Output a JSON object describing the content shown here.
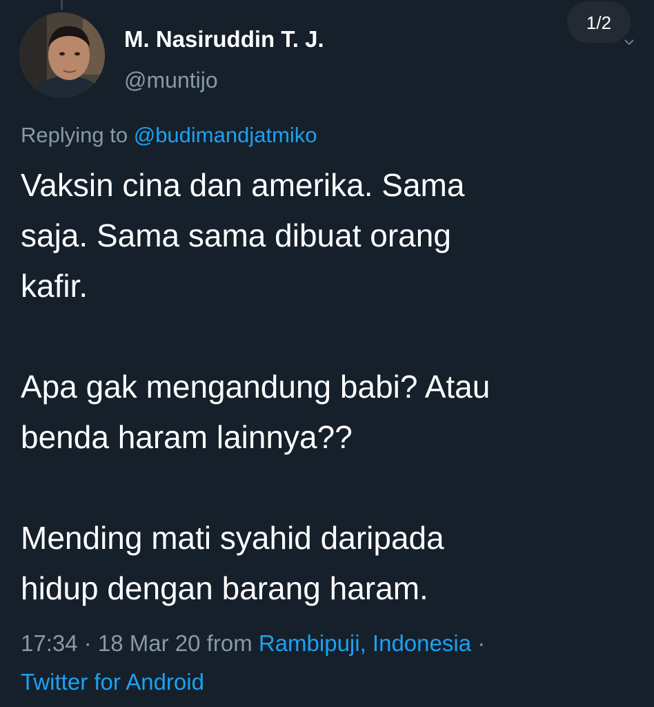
{
  "tweet": {
    "author": {
      "name": "M. Nasiruddin T. J.",
      "handle": "@muntijo"
    },
    "page_indicator": "1/2",
    "reply": {
      "prefix": "Replying to ",
      "mention": "@budimandjatmiko"
    },
    "text_lines": [
      "Vaksin cina dan amerika. Sama",
      "saja. Sama sama dibuat orang",
      "kafir.",
      "Apa gak mengandung babi? Atau",
      "benda haram lainnya??",
      "Mending mati syahid daripada",
      "hidup dengan barang haram."
    ],
    "meta": {
      "time": "17:34",
      "sep1": " · ",
      "date": "18 Mar 20",
      "from": " from ",
      "location": "Rambipuji, Indonesia",
      "sep2": " ·",
      "source": "Twitter for Android"
    }
  },
  "colors": {
    "background": "#15202b",
    "primary_text": "#ffffff",
    "secondary_text": "#8899a6",
    "link": "#1da1f2"
  },
  "icons": {
    "avatar": "avatar-photo",
    "badge_chevron": "chevron-down-icon"
  }
}
